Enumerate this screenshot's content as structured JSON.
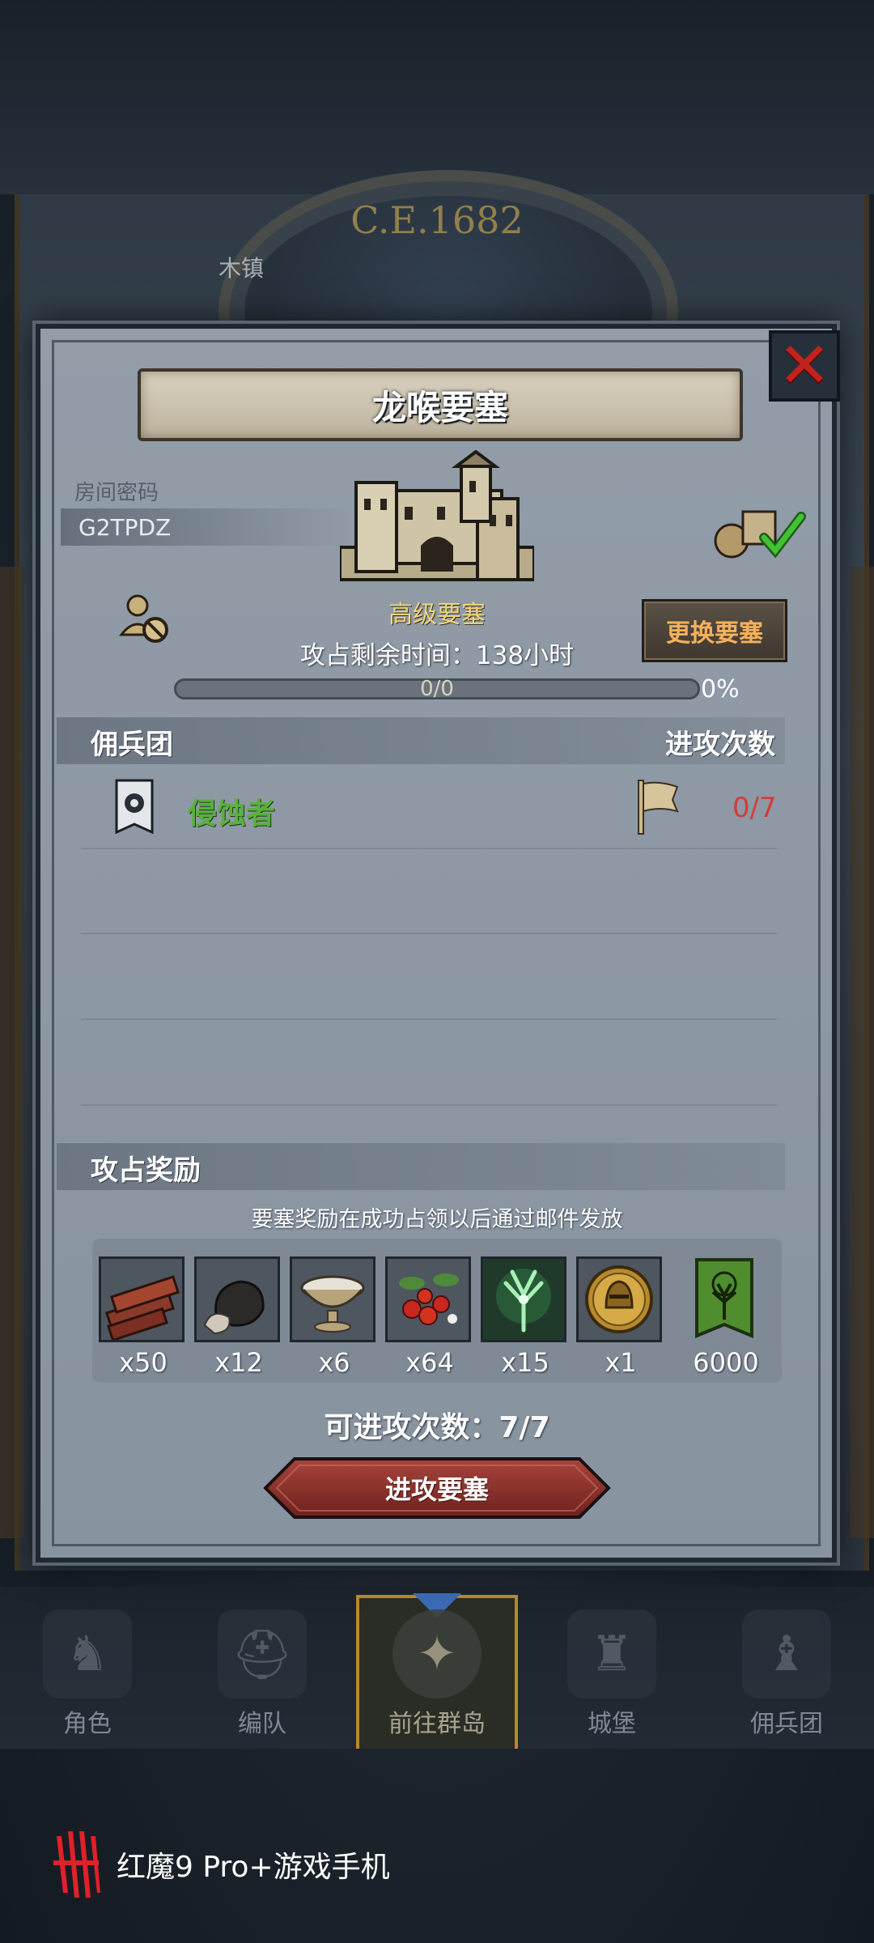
{
  "background": {
    "year": "C.E.1682",
    "town_label": "木镇"
  },
  "dialog": {
    "title": "龙喉要塞",
    "room_code_label": "房间密码",
    "room_code": "G2TPDZ",
    "fortress_level": "高级要塞",
    "change_button": "更换要塞",
    "time_remaining": "攻占剩余时间：138小时",
    "progress": {
      "label": "0/0",
      "percent_text": "0%",
      "fraction": 0
    },
    "mercenary_header": "佣兵团",
    "attack_count_header": "进攻次数",
    "mercenaries": [
      {
        "name": "侵蚀者",
        "count": "0/7"
      }
    ],
    "rewards_header": "攻占奖励",
    "rewards_note": "要塞奖励在成功占领以后通过邮件发放",
    "rewards": [
      {
        "icon": "wood-logs-icon",
        "qty": "x50"
      },
      {
        "icon": "ore-stone-icon",
        "qty": "x12"
      },
      {
        "icon": "salt-bowl-icon",
        "qty": "x6"
      },
      {
        "icon": "berries-icon",
        "qty": "x64"
      },
      {
        "icon": "green-spirit-tree-icon",
        "qty": "x15"
      },
      {
        "icon": "golden-helmet-medal-icon",
        "qty": "x1"
      },
      {
        "icon": "green-tree-banner-icon",
        "qty": "6000"
      }
    ],
    "attacks_available": "可进攻次数：7/7",
    "attack_button": "进攻要塞"
  },
  "bottom_nav": {
    "items": [
      {
        "label": "角色"
      },
      {
        "label": "编队"
      },
      {
        "label": "前往群岛"
      },
      {
        "label": "城堡"
      },
      {
        "label": "佣兵团"
      }
    ],
    "active_index": 2
  },
  "brand": {
    "text": "红魔9 Pro+游戏手机"
  },
  "colors": {
    "merc_name": "#58b13c",
    "count_red": "#d23b3b",
    "change_button_text": "#f5b15a",
    "close_x": "#c0221c"
  }
}
